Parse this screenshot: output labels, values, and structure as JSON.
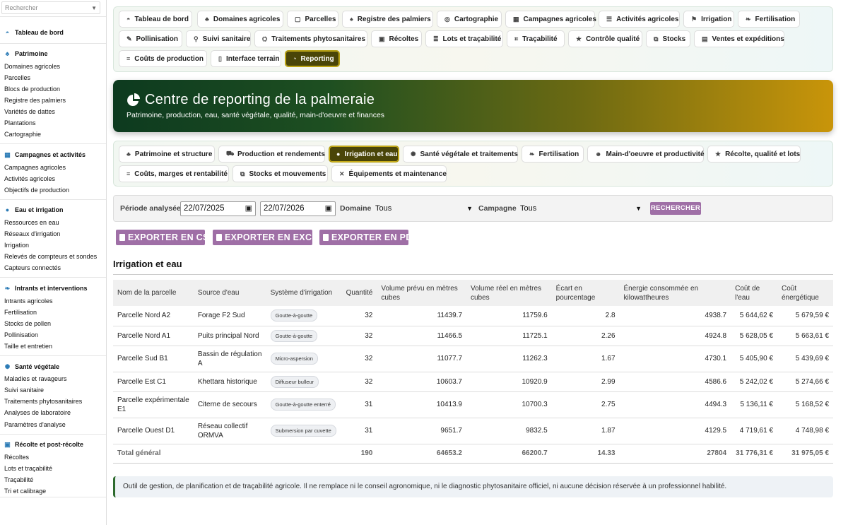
{
  "sidebar": {
    "search_placeholder": "Rechercher",
    "dashboard": "Tableau de bord",
    "patrimoine": {
      "title": "Patrimoine",
      "items": [
        "Domaines agricoles",
        "Parcelles",
        "Blocs de production",
        "Registre des palmiers",
        "Variétés de dattes",
        "Plantations",
        "Cartographie"
      ]
    },
    "campagnes": {
      "title": "Campagnes et activités",
      "items": [
        "Campagnes agricoles",
        "Activités agricoles",
        "Objectifs de production"
      ]
    },
    "eau": {
      "title": "Eau et irrigation",
      "items": [
        "Ressources en eau",
        "Réseaux d'irrigation",
        "Irrigation",
        "Relevés de compteurs et sondes",
        "Capteurs connectés"
      ]
    },
    "intrants": {
      "title": "Intrants et interventions",
      "items": [
        "Intrants agricoles",
        "Fertilisation",
        "Stocks de pollen",
        "Pollinisation",
        "Taille et entretien"
      ]
    },
    "sante": {
      "title": "Santé végétale",
      "items": [
        "Maladies et ravageurs",
        "Suivi sanitaire",
        "Traitements phytosanitaires",
        "Analyses de laboratoire",
        "Paramètres d'analyse"
      ]
    },
    "recolte": {
      "title": "Récolte et post-récolte",
      "items": [
        "Récoltes",
        "Lots et traçabilité",
        "Traçabilité",
        "Tri et calibrage"
      ]
    }
  },
  "topnav": [
    "Tableau de bord",
    "Domaines agricoles",
    "Parcelles",
    "Registre des palmiers",
    "Cartographie",
    "Campagnes agricoles",
    "Activités agricoles",
    "Irrigation",
    "Fertilisation",
    "Pollinisation",
    "Suivi sanitaire",
    "Traitements phytosanitaires",
    "Récoltes",
    "Lots et traçabilité",
    "Traçabilité",
    "Contrôle qualité",
    "Stocks",
    "Ventes et expéditions",
    "Coûts de production",
    "Interface terrain",
    "Reporting"
  ],
  "hero": {
    "title": "Centre de reporting de la palmeraie",
    "subtitle": "Patrimoine, production, eau, santé végétale, qualité, main-d'oeuvre et finances"
  },
  "subnav": [
    "Patrimoine et structure",
    "Production et rendements",
    "Irrigation et eau",
    "Santé végétale et traitements",
    "Fertilisation",
    "Main-d'oeuvre et productivité",
    "Récolte, qualité et lots",
    "Coûts, marges et rentabilité",
    "Stocks et mouvements",
    "Équipements et maintenance"
  ],
  "filters": {
    "period_label": "Période analysée",
    "date_from": "22/07/2025",
    "date_to": "22/07/2026",
    "domain_label": "Domaine",
    "domain_value": "Tous",
    "campaign_label": "Campagne",
    "campaign_value": "Tous",
    "search_button": "RECHERCHER"
  },
  "exports": [
    "EXPORTER EN CSV",
    "EXPORTER EN EXCEL",
    "EXPORTER EN PDF"
  ],
  "section_title": "Irrigation et eau",
  "table": {
    "headers": [
      "Nom de la parcelle",
      "Source d'eau",
      "Système d'irrigation",
      "Quantité",
      "Volume prévu en mètres cubes",
      "Volume réel en mètres cubes",
      "Écart en pourcentage",
      "Énergie consommée en kilowattheures",
      "Coût de l'eau",
      "Coût énergétique"
    ],
    "rows": [
      [
        "Parcelle Nord A2",
        "Forage F2 Sud",
        "Goutte-à-goutte",
        "32",
        "11439.7",
        "11759.6",
        "2.8",
        "4938.7",
        "5 644,62 €",
        "5 679,59 €"
      ],
      [
        "Parcelle Nord A1",
        "Puits principal Nord",
        "Goutte-à-goutte",
        "32",
        "11466.5",
        "11725.1",
        "2.26",
        "4924.8",
        "5 628,05 €",
        "5 663,61 €"
      ],
      [
        "Parcelle Sud B1",
        "Bassin de régulation A",
        "Micro-aspersion",
        "32",
        "11077.7",
        "11262.3",
        "1.67",
        "4730.1",
        "5 405,90 €",
        "5 439,69 €"
      ],
      [
        "Parcelle Est C1",
        "Khettara historique",
        "Diffuseur bulleur",
        "32",
        "10603.7",
        "10920.9",
        "2.99",
        "4586.6",
        "5 242,02 €",
        "5 274,66 €"
      ],
      [
        "Parcelle expérimentale E1",
        "Citerne de secours",
        "Goutte-à-goutte enterré",
        "31",
        "10413.9",
        "10700.3",
        "2.75",
        "4494.3",
        "5 136,11 €",
        "5 168,52 €"
      ],
      [
        "Parcelle Ouest D1",
        "Réseau collectif ORMVA",
        "Submersion par cuvette",
        "31",
        "9651.7",
        "9832.5",
        "1.87",
        "4129.5",
        "4 719,61 €",
        "4 748,98 €"
      ]
    ],
    "total": [
      "Total général",
      "",
      "",
      "190",
      "64653.2",
      "66200.7",
      "14.33",
      "27804",
      "31 776,31 €",
      "31 975,05 €"
    ]
  },
  "notice": "Outil de gestion, de planification et de traçabilité agricole. Il ne remplace ni le conseil agronomique, ni le diagnostic phytosanitaire officiel, ni aucune décision réservée à un professionnel habilité."
}
